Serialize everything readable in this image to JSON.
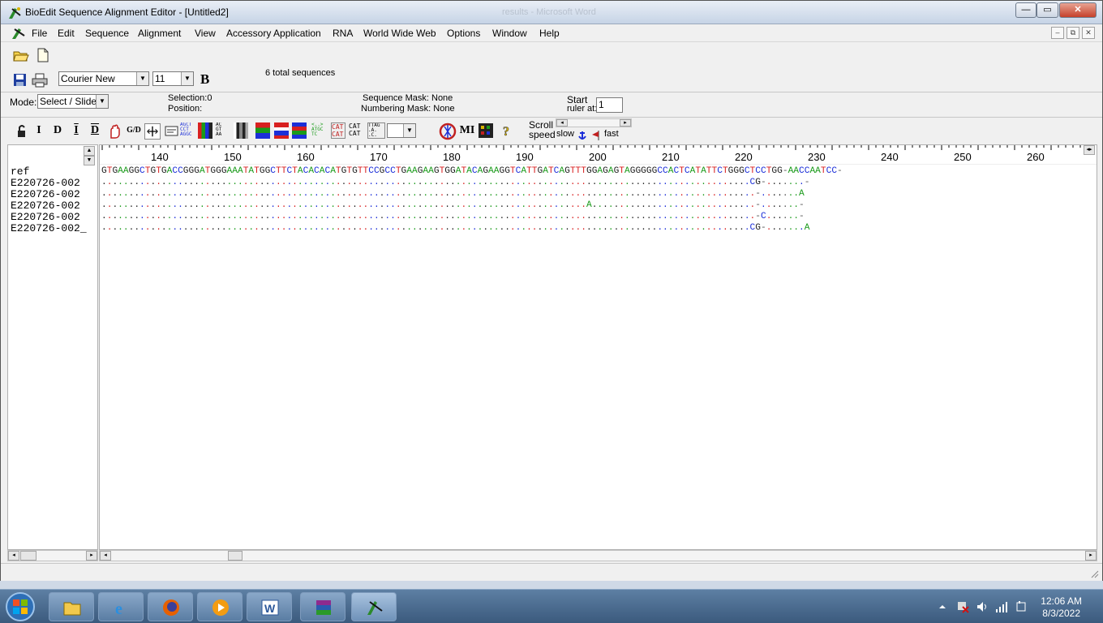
{
  "window": {
    "title": "BioEdit Sequence Alignment Editor - [Untitled2]",
    "background_title": "results - Microsoft Word",
    "buttons": {
      "minimize": "—",
      "maximize": "▭",
      "close": "✕"
    }
  },
  "menubar": {
    "items": [
      "File",
      "Edit",
      "Sequence",
      "Alignment",
      "View",
      "Accessory Application",
      "RNA",
      "World Wide Web",
      "Options",
      "Window",
      "Help"
    ],
    "mdi_buttons": [
      "–",
      "⧉",
      "✕"
    ]
  },
  "toolbar": {
    "font_name": "Courier New",
    "font_size": "11",
    "bold_label": "B",
    "sequence_count": "6 total sequences"
  },
  "info_bar": {
    "mode_label": "Mode:",
    "mode_value": "Select / Slide",
    "selection_label": "Selection:",
    "selection_value": "0",
    "position_label": "Position:",
    "sequence_mask_label": "Sequence Mask:",
    "sequence_mask_value": "None",
    "numbering_mask_label": "Numbering Mask:",
    "numbering_mask_value": "None",
    "start_label": "Start",
    "ruler_at_label": "ruler at:",
    "ruler_value": "1"
  },
  "tools": {
    "labels": [
      "I",
      "D",
      "I",
      "D",
      "G/D"
    ],
    "mi_label": "MI",
    "scroll_label": "Scroll",
    "speed_label": "speed",
    "slow_label": "slow",
    "fast_label": "fast"
  },
  "ruler": {
    "labels": [
      "140",
      "150",
      "160",
      "170",
      "180",
      "190",
      "200",
      "210",
      "220",
      "230",
      "240",
      "250",
      "260"
    ]
  },
  "sequences": {
    "names": [
      "ref",
      "E220726-002",
      "E220726-002",
      "E220726-002",
      "E220726-002",
      "E220726-002_"
    ],
    "rows": [
      "GTGAAGGCTGTGACCGGGATGGGAAATATGGCTTCTACACACATGTGTTCCGCCTGAAGAAGTGGATACAGAAGGTCATTGATCAGTTTGGAGAGTAGGGGGCCACTCATATTCTGGGCTCCTGG-AACCAATCC-",
      ".......................................................................................................................CG-.......-",
      "........................................................................................................................-.......A",
      ".........................................................................................A..............................-.......-",
      "........................................................................................................................-C......-",
      ".......................................................................................................................CG-.......A"
    ]
  },
  "colors": {
    "A": "#1a9a1a",
    "C": "#1c2fd8",
    "G": "#222222",
    "T": "#d82020",
    "gap": "#555555"
  },
  "taskbar": {
    "time": "12:06 AM",
    "date": "8/3/2022",
    "apps": [
      "start-orb",
      "file-explorer",
      "internet-explorer",
      "firefox",
      "media-player",
      "microsoft-word",
      "winrar",
      "bioedit"
    ]
  }
}
